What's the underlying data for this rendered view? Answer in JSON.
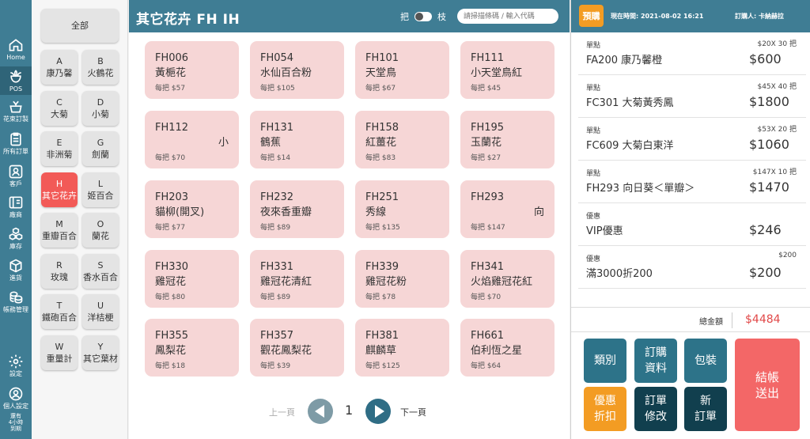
{
  "nav": {
    "items": [
      {
        "label": "Home"
      },
      {
        "label": "POS"
      },
      {
        "label": "花束訂製"
      },
      {
        "label": "所有訂單"
      },
      {
        "label": "客戶"
      },
      {
        "label": "廠商"
      },
      {
        "label": "庫存"
      },
      {
        "label": "進貨"
      },
      {
        "label": "帳務管理"
      },
      {
        "label": "設定"
      },
      {
        "label": "個人設定"
      },
      {
        "label": "還有\n4小時\n到期"
      }
    ]
  },
  "categories": [
    {
      "letter": "",
      "name": "全部"
    },
    {
      "letter": "A",
      "name": "康乃馨"
    },
    {
      "letter": "B",
      "name": "火鶴花"
    },
    {
      "letter": "C",
      "name": "大菊"
    },
    {
      "letter": "D",
      "name": "小菊"
    },
    {
      "letter": "E",
      "name": "非洲菊"
    },
    {
      "letter": "G",
      "name": "劍蘭"
    },
    {
      "letter": "H",
      "name": "其它花卉"
    },
    {
      "letter": "L",
      "name": "姬百合"
    },
    {
      "letter": "M",
      "name": "重瓣百合"
    },
    {
      "letter": "O",
      "name": "蘭花"
    },
    {
      "letter": "R",
      "name": "玫瑰"
    },
    {
      "letter": "S",
      "name": "香水百合"
    },
    {
      "letter": "T",
      "name": "鐵砲百合"
    },
    {
      "letter": "U",
      "name": "洋桔梗"
    },
    {
      "letter": "W",
      "name": "重量計"
    },
    {
      "letter": "Y",
      "name": "其它葉材"
    }
  ],
  "main": {
    "title": "其它花卉 FH IH",
    "toggle_left": "把",
    "toggle_right": "枝",
    "search_placeholder": "請掃描條碼 / 輸入代碼"
  },
  "products": [
    {
      "code": "FH006",
      "name": "黃梔花",
      "price": "每把 $57"
    },
    {
      "code": "FH054",
      "name": "水仙百合粉",
      "price": "每把 $105"
    },
    {
      "code": "FH101",
      "name": "天堂鳥",
      "price": "每把 $67"
    },
    {
      "code": "FH111",
      "name": "小天堂鳥紅",
      "price": "每把 $45"
    },
    {
      "code": "FH112",
      "name": "小",
      "price": "每把 $70"
    },
    {
      "code": "FH131",
      "name": "鶴蕉",
      "price": "每把 $14"
    },
    {
      "code": "FH158",
      "name": "紅薑花",
      "price": "每把 $83"
    },
    {
      "code": "FH195",
      "name": "玉蘭花",
      "price": "每把 $27"
    },
    {
      "code": "FH203",
      "name": "貓柳(開叉)",
      "price": "每把 $77"
    },
    {
      "code": "FH232",
      "name": "夜來香重瓣",
      "price": "每把 $89"
    },
    {
      "code": "FH251",
      "name": "秀線",
      "price": "每把 $135"
    },
    {
      "code": "FH293",
      "name": "向",
      "price": "每把 $147"
    },
    {
      "code": "FH330",
      "name": "雞冠花",
      "price": "每把 $80"
    },
    {
      "code": "FH331",
      "name": "雞冠花清紅",
      "price": "每把 $89"
    },
    {
      "code": "FH339",
      "name": "雞冠花粉",
      "price": "每把 $78"
    },
    {
      "code": "FH341",
      "name": "火焰雞冠花紅",
      "price": "每把 $70"
    },
    {
      "code": "FH355",
      "name": "鳳梨花",
      "price": "每把 $18"
    },
    {
      "code": "FH357",
      "name": "觀花鳳梨花",
      "price": "每把 $39"
    },
    {
      "code": "FH381",
      "name": "麒麟草",
      "price": "每把 $125"
    },
    {
      "code": "FH661",
      "name": "伯利恆之星",
      "price": "每把 $64"
    }
  ],
  "pager": {
    "prev": "上一頁",
    "page": "1",
    "next": "下一頁"
  },
  "order": {
    "badge": "預購",
    "time": "現在時間: 2021-08-02 16:21",
    "orderer": "訂購人: 卡納赫拉",
    "lines": [
      {
        "type": "單點",
        "desc": "FA200 康乃馨橙",
        "qty": "$20X 30 把",
        "amount": "$600"
      },
      {
        "type": "單點",
        "desc": "FC301 大菊黃秀鳳",
        "qty": "$45X 40 把",
        "amount": "$1800"
      },
      {
        "type": "單點",
        "desc": "FC609 大菊白東洋",
        "qty": "$53X 20 把",
        "amount": "$1060"
      },
      {
        "type": "單點",
        "desc": "FH293 向日葵＜單瓣＞",
        "qty": "$147X 10 把",
        "amount": "$1470"
      },
      {
        "type": "優惠",
        "desc": "VIP優惠",
        "qty": "",
        "amount": "$246"
      },
      {
        "type": "優惠",
        "desc": "滿3000折200",
        "qty": "$200",
        "amount": "$200"
      }
    ],
    "total_label": "總金額",
    "total": "$4484"
  },
  "actions": {
    "category": "類別",
    "order_info": "訂購\n資料",
    "packaging": "包裝",
    "discount": "優惠\n折扣",
    "edit_order": "訂單\n修改",
    "new_order": "新\n訂單",
    "checkout": "結帳\n送出"
  },
  "colors": {
    "primary": "#3f7d94",
    "accent": "#f25a57",
    "card": "#f6d6d6",
    "orange": "#f39c23",
    "dark": "#113f4e"
  }
}
